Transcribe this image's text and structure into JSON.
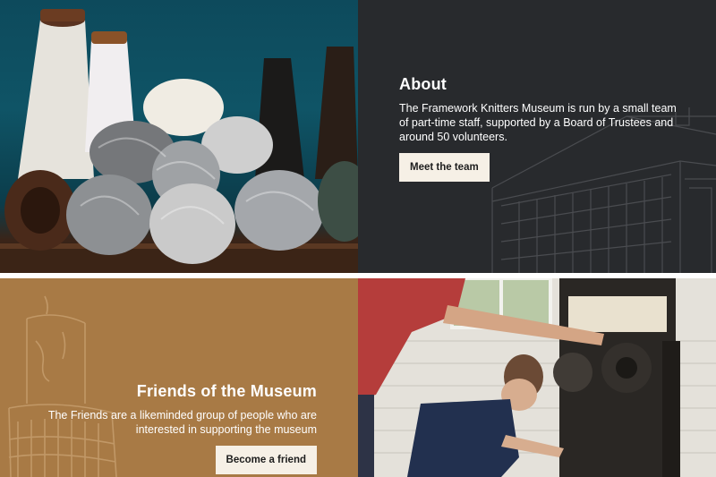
{
  "about": {
    "title": "About",
    "text": "The Framework Knitters Museum is run by a small team of part-time staff, supported by a Board of Trustees and around 50 volunteers.",
    "button": "Meet the team"
  },
  "friends": {
    "title": "Friends of the Museum",
    "text": "The Friends are a likeminded group of people who are interested in supporting the museum",
    "button": "Become a friend"
  },
  "colors": {
    "about_bg": "#282a2d",
    "friends_bg": "#a87a45",
    "button_bg": "#f6f0e6",
    "yarn_backdrop": "#0f5466"
  },
  "images": {
    "yarn": "yarn-bobbins-photo",
    "workshop": "knitting-frame-workshop-photo",
    "about_decor": "factory-building-line-art",
    "friends_decor": "candle-line-art"
  }
}
